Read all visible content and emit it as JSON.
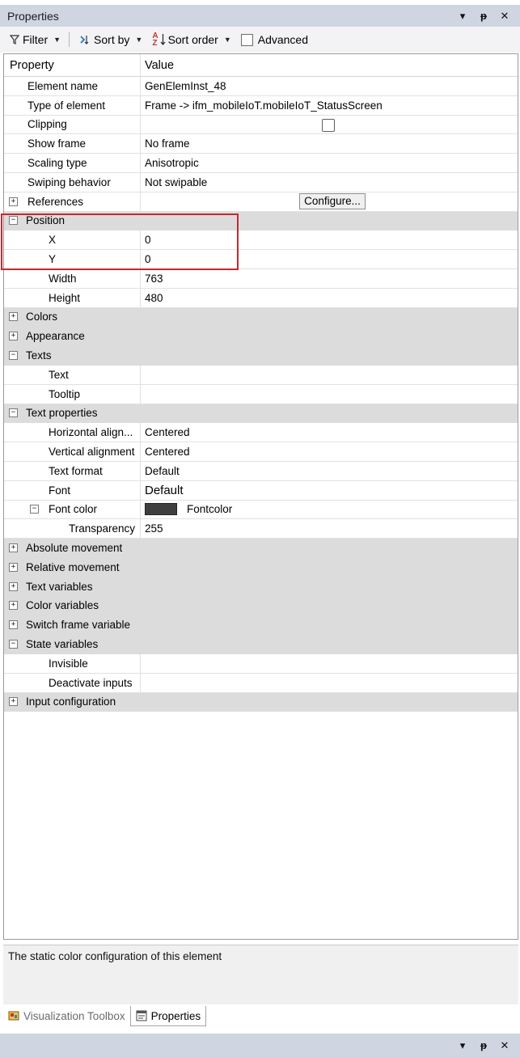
{
  "panel": {
    "title": "Properties",
    "controls": {
      "dropdown": "▾",
      "pin": "ᵽ",
      "close": "✕"
    }
  },
  "toolbar": {
    "filter_label": "Filter",
    "sort_by_label": "Sort by",
    "sort_order_label": "Sort order",
    "advanced_label": "Advanced",
    "advanced_checked": false
  },
  "grid": {
    "header": {
      "property": "Property",
      "value": "Value"
    },
    "rows": [
      {
        "label": "Element name",
        "value": "GenElemInst_48"
      },
      {
        "label": "Type of element",
        "value": "Frame -> ifm_mobileIoT.mobileIoT_StatusScreen"
      },
      {
        "label": "Clipping",
        "value": ""
      },
      {
        "label": "Show frame",
        "value": "No frame"
      },
      {
        "label": "Scaling type",
        "value": "Anisotropic"
      },
      {
        "label": "Swiping behavior",
        "value": "Not swipable"
      },
      {
        "label": "References",
        "button": "Configure..."
      },
      {
        "label": "Position"
      },
      {
        "label": "X",
        "value": "0"
      },
      {
        "label": "Y",
        "value": "0"
      },
      {
        "label": "Width",
        "value": "763"
      },
      {
        "label": "Height",
        "value": "480"
      },
      {
        "label": "Colors"
      },
      {
        "label": "Appearance"
      },
      {
        "label": "Texts"
      },
      {
        "label": "Text",
        "value": ""
      },
      {
        "label": "Tooltip",
        "value": ""
      },
      {
        "label": "Text properties"
      },
      {
        "label": "Horizontal align...",
        "value": "Centered"
      },
      {
        "label": "Vertical alignment",
        "value": "Centered"
      },
      {
        "label": "Text format",
        "value": "Default"
      },
      {
        "label": "Font",
        "value": "Default"
      },
      {
        "label": "Font color",
        "value": "Fontcolor",
        "swatch": "#3f3f3f"
      },
      {
        "label": "Transparency",
        "value": "255"
      },
      {
        "label": "Absolute movement"
      },
      {
        "label": "Relative movement"
      },
      {
        "label": "Text variables"
      },
      {
        "label": "Color variables"
      },
      {
        "label": "Switch frame variable"
      },
      {
        "label": "State variables"
      },
      {
        "label": "Invisible",
        "value": ""
      },
      {
        "label": "Deactivate inputs",
        "value": ""
      },
      {
        "label": "Input configuration"
      }
    ]
  },
  "toggles": {
    "expand": "+",
    "collapse": "−"
  },
  "description": "The static color configuration of this element",
  "tabs": [
    {
      "label": "Visualization Toolbox",
      "active": false
    },
    {
      "label": "Properties",
      "active": true
    }
  ],
  "colors": {
    "titlebar": "#cfd6e2",
    "group_row": "#dcdcdc",
    "highlight": "#c8282d"
  }
}
